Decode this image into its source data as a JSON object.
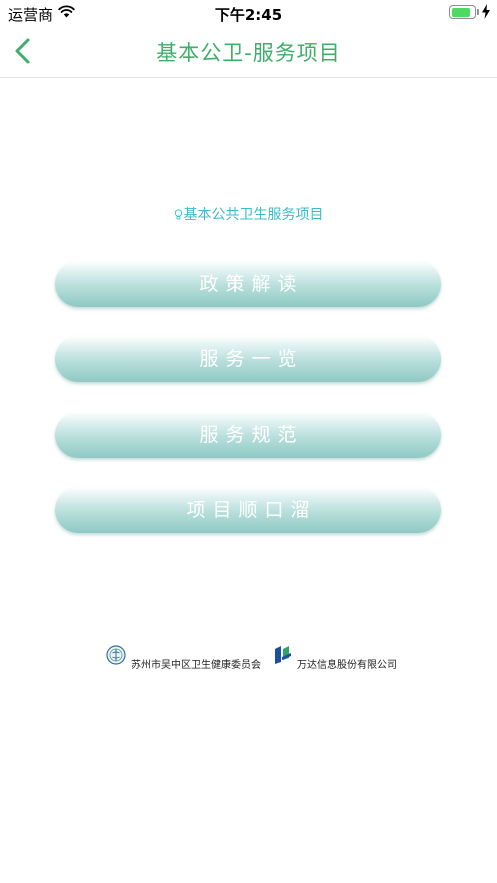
{
  "status_bar": {
    "carrier": "运营商",
    "time": "下午2:45",
    "battery_level": 0.85
  },
  "nav": {
    "title": "基本公卫-服务项目"
  },
  "subtitle": "基本公共卫生服务项目",
  "menu": [
    {
      "label": "政策解读"
    },
    {
      "label": "服务一览"
    },
    {
      "label": "服务规范"
    },
    {
      "label": "项目顺口溜"
    }
  ],
  "footer": {
    "organization": "苏州市吴中区卫生健康委员会",
    "company": "万达信息股份有限公司"
  },
  "colors": {
    "accent": "#3fae6a",
    "subtitle": "#3bbcc7",
    "button_bottom": "#8fc9c4",
    "battery": "#4cd964"
  }
}
